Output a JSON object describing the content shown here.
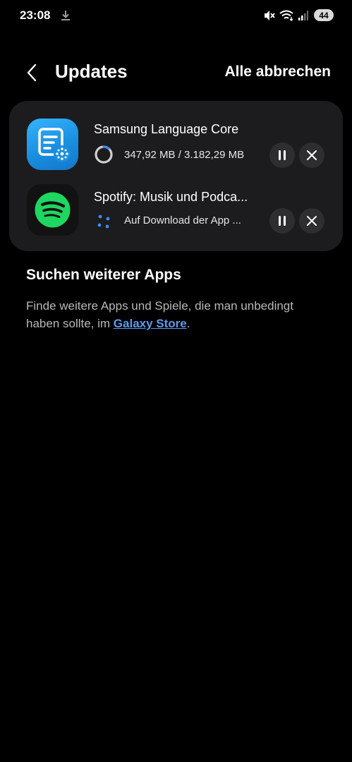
{
  "status_bar": {
    "time": "23:08",
    "battery": "44",
    "icons": [
      "download-icon",
      "mute-icon",
      "wifi-icon",
      "signal-icon",
      "battery-icon"
    ]
  },
  "header": {
    "title": "Updates",
    "cancel_all_label": "Alle abbrechen"
  },
  "updates": [
    {
      "name": "Samsung Language Core",
      "status": "347,92 MB / 3.182,29 MB",
      "progress": 0.11,
      "icon": "samsung-language-core-icon"
    },
    {
      "name": "Spotify: Musik und Podca...",
      "status": "Auf Download der App ...",
      "icon": "spotify-icon"
    }
  ],
  "suggestion": {
    "title": "Suchen weiterer Apps",
    "text_before": "Finde weitere Apps und Spiele, die man unbedingt haben sollte, im ",
    "link_label": "Galaxy Store",
    "text_after": "."
  },
  "colors": {
    "background": "#000000",
    "card": "#1c1c1e",
    "link": "#5b9bf0",
    "spotify_green": "#1ed760",
    "samsung_blue": "#1a8fe0"
  }
}
